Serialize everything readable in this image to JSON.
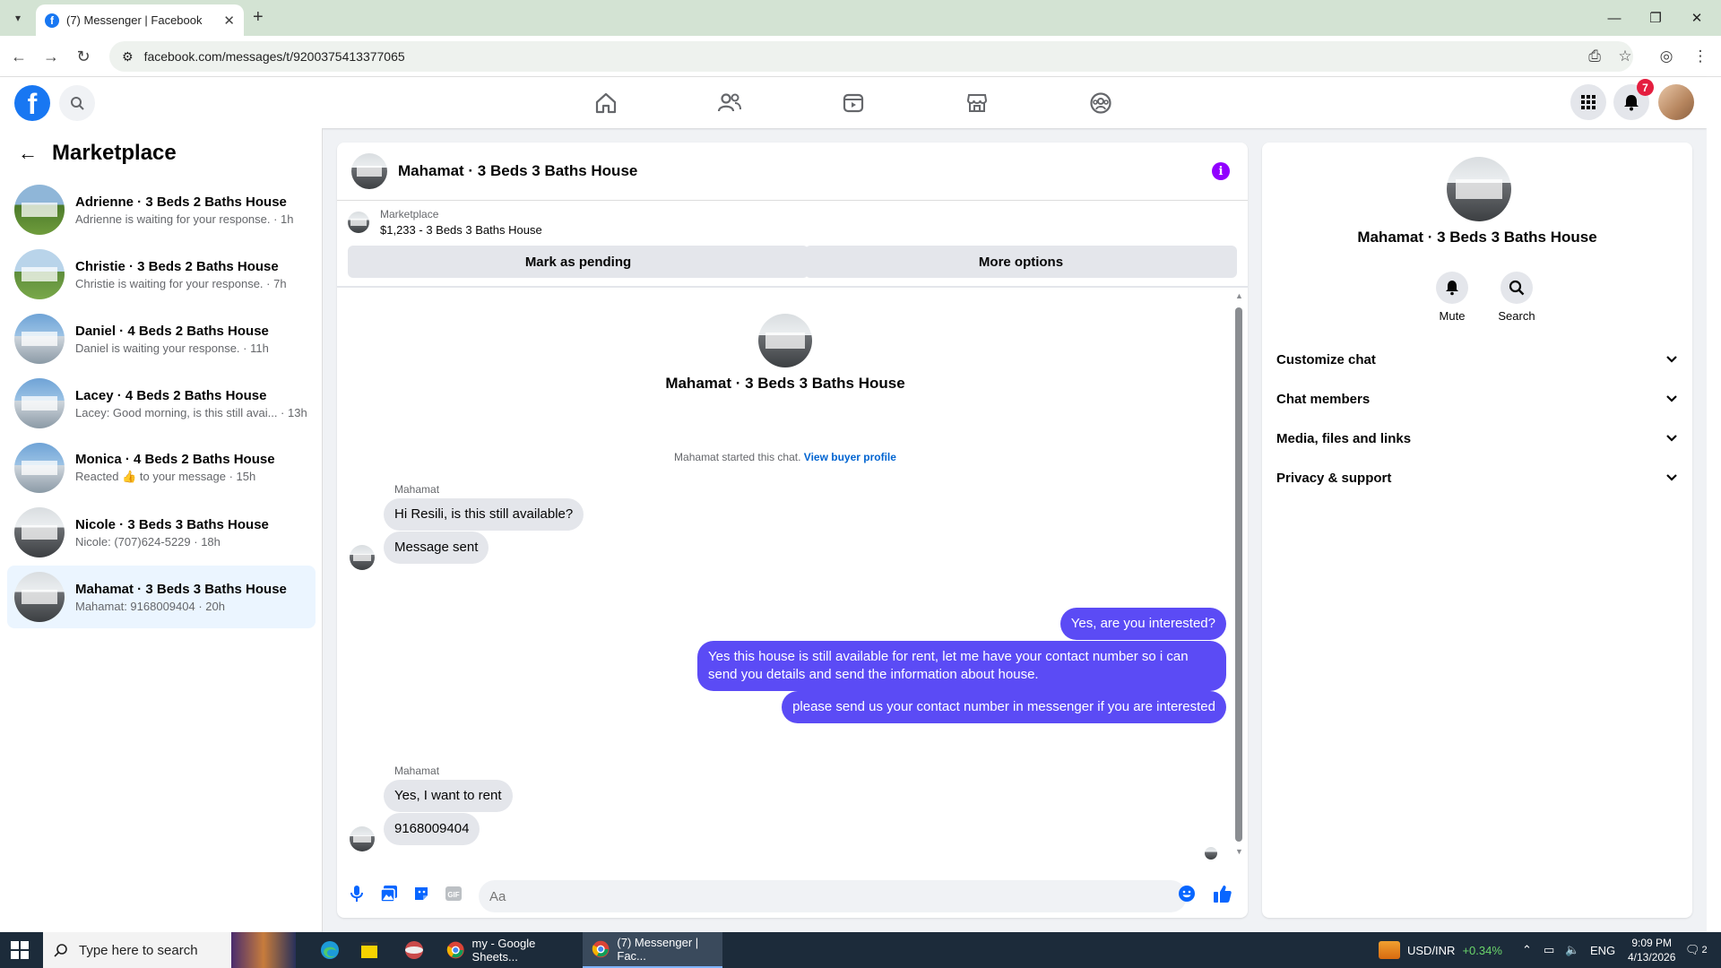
{
  "browser": {
    "tab_title": "(7) Messenger | Facebook",
    "url": "facebook.com/messages/t/9200375413377065"
  },
  "fb_header": {
    "notification_count": "7"
  },
  "left_panel": {
    "title": "Marketplace",
    "conversations": [
      {
        "name": "Adrienne · 3 Beds 2 Baths House",
        "preview": "Adrienne is waiting for your response. · 1h"
      },
      {
        "name": "Christie · 3 Beds 2 Baths House",
        "preview": "Christie is waiting for your response. · 7h"
      },
      {
        "name": "Daniel · 4 Beds 2 Baths House",
        "preview": "Daniel is waiting your response. · 11h"
      },
      {
        "name": "Lacey · 4 Beds 2 Baths House",
        "preview": "Lacey: Good morning, is this still avai... · 13h"
      },
      {
        "name": "Monica · 4 Beds 2 Baths House",
        "preview_before": "Reacted",
        "preview_emoji": "👍",
        "preview_after": "to your message · 15h"
      },
      {
        "name": "Nicole · 3 Beds 3 Baths House",
        "preview": "Nicole: (707)624-5229 · 18h"
      },
      {
        "name": "Mahamat · 3 Beds 3 Baths House",
        "preview": "Mahamat: 9168009404 · 20h"
      }
    ]
  },
  "chat": {
    "title": "Mahamat · 3 Beds 3 Baths House",
    "listing_label": "Marketplace",
    "listing_price": "$1,233 - 3 Beds 3 Baths House",
    "mark_pending": "Mark as pending",
    "more_options": "More options",
    "intro_name": "Mahamat · 3 Beds 3 Baths House",
    "started_text": "Mahamat started this chat.",
    "view_buyer_profile": "View buyer profile",
    "sender_name": "Mahamat",
    "messages_in_1": [
      "Hi Resili, is this still available?",
      "Message sent"
    ],
    "messages_out": [
      "Yes, are you interested?",
      "Yes this house is still available for rent, let me have your contact number so i can send you details and send the information about house.",
      "please  send us your contact number in messenger if you are interested"
    ],
    "messages_in_2": [
      "Yes, I want to rent",
      "9168009404"
    ],
    "composer_placeholder": "Aa"
  },
  "right_panel": {
    "name": "Mahamat · 3 Beds 3 Baths House",
    "mute_label": "Mute",
    "search_label": "Search",
    "sections": [
      "Customize chat",
      "Chat members",
      "Media, files and links",
      "Privacy & support"
    ]
  },
  "taskbar": {
    "search_placeholder": "Type here to search",
    "task_sheets": "my - Google Sheets...",
    "task_messenger": "(7) Messenger | Fac...",
    "ticker_name": "USD/INR",
    "ticker_change": "+0.34%",
    "lang": "ENG",
    "time": "9:09 PM",
    "date": "4/13/2026",
    "action_center_count": "2"
  },
  "colors": {
    "fb_blue": "#1877f2",
    "outgoing_bubble": "#5b4bf5",
    "info_purple": "#9100ff",
    "notif_red": "#e41e3f"
  }
}
